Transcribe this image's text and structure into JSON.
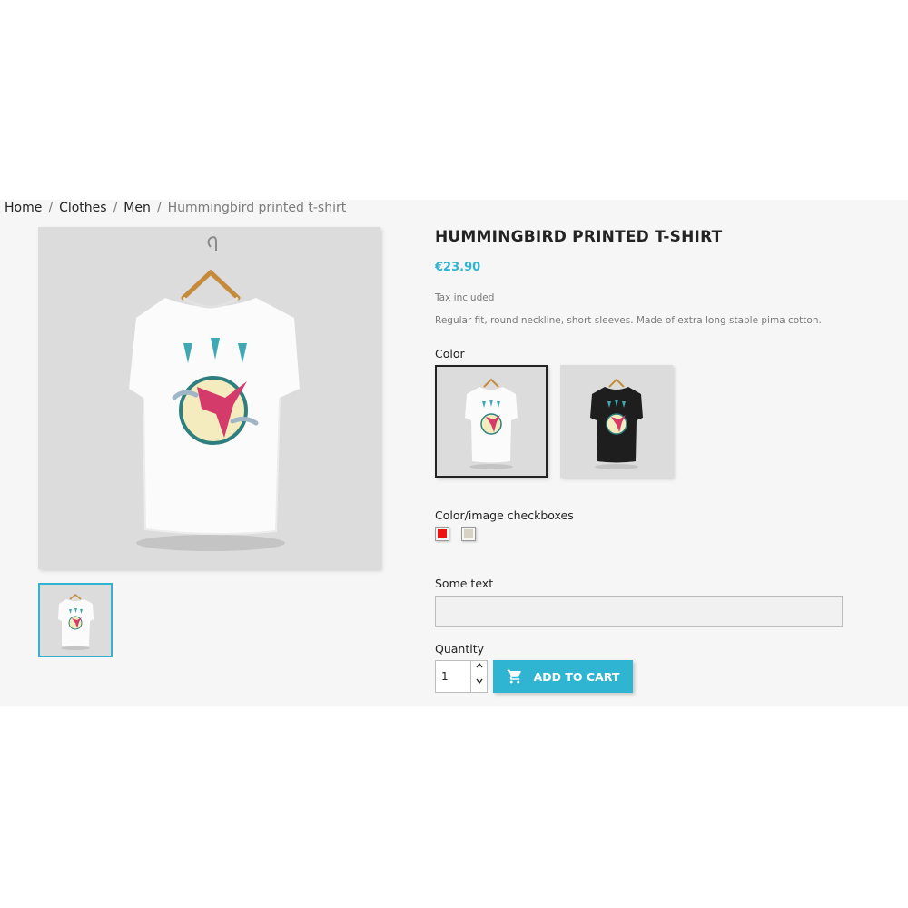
{
  "breadcrumb": {
    "items": [
      "Home",
      "Clothes",
      "Men"
    ],
    "current": "Hummingbird printed t-shirt",
    "separator": "/"
  },
  "product": {
    "title": "HUMMINGBIRD PRINTED T-SHIRT",
    "price": "€23.90",
    "tax_note": "Tax included",
    "description": "Regular fit, round neckline, short sleeves. Made of extra long staple pima cotton."
  },
  "color_section": {
    "label": "Color",
    "options": [
      {
        "shirt_color": "#ffffff",
        "selected": true
      },
      {
        "shirt_color": "#1e1e1e",
        "selected": false
      }
    ]
  },
  "checkbox_section": {
    "label": "Color/image checkboxes",
    "swatches": [
      {
        "color": "#ee1111"
      },
      {
        "color": "#d8d2c4"
      }
    ]
  },
  "custom_text": {
    "label": "Some text",
    "value": ""
  },
  "quantity": {
    "label": "Quantity",
    "value": "1",
    "up_icon": "chevron-up-icon",
    "down_icon": "chevron-down-icon"
  },
  "add_to_cart": {
    "label": "ADD TO CART",
    "icon": "cart-icon"
  },
  "colors": {
    "accent": "#2fb5d2",
    "band_background": "#f6f6f6",
    "image_background": "#dcdcdc"
  }
}
